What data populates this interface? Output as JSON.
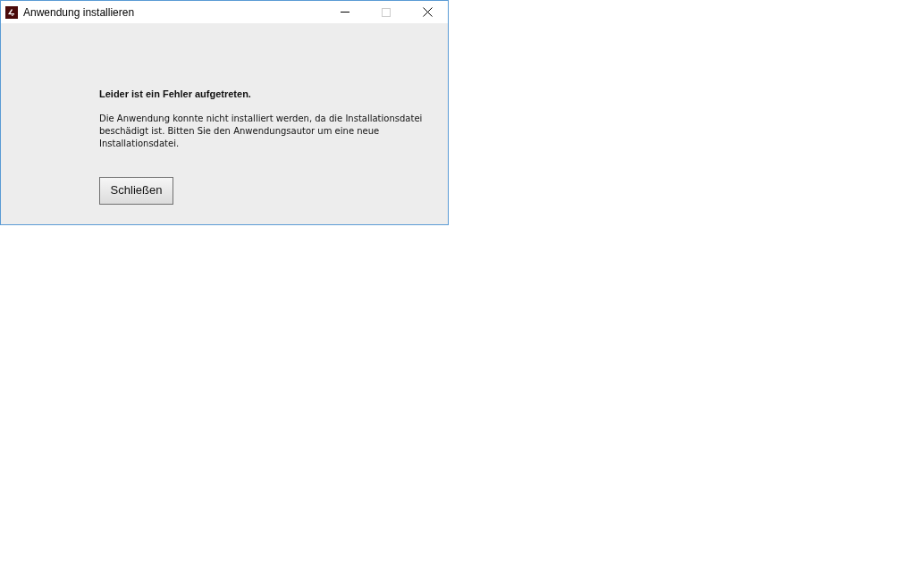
{
  "window": {
    "title": "Anwendung installieren"
  },
  "error": {
    "heading": "Leider ist ein Fehler aufgetreten.",
    "message": "Die Anwendung konnte nicht installiert werden, da die Installationsdatei beschädigt ist. Bitten Sie den Anwendungsautor um eine neue Installationsdatei."
  },
  "buttons": [
    {
      "label": "Schließen"
    }
  ]
}
